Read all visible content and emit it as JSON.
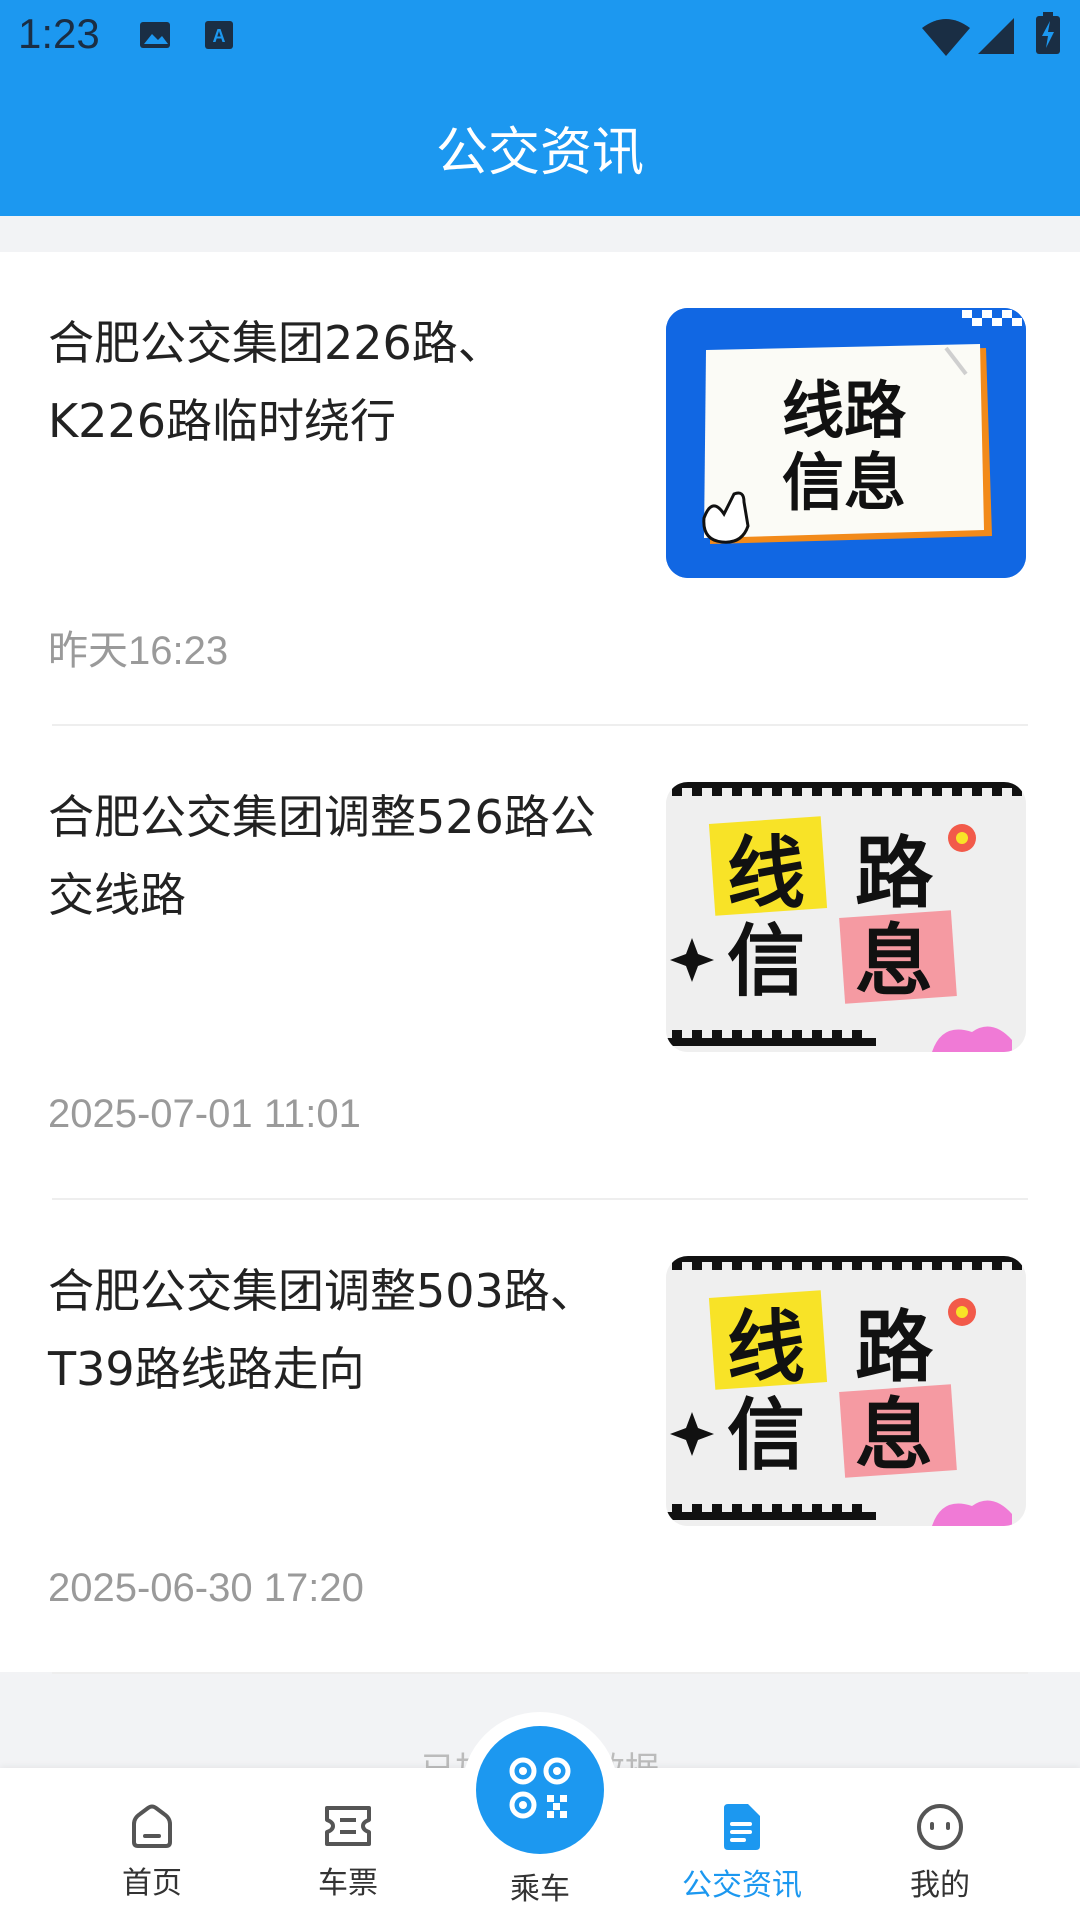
{
  "status_bar": {
    "time": "1:23",
    "icons": [
      "image-icon",
      "a-box-icon",
      "wifi-icon",
      "signal-icon",
      "battery-charging-icon"
    ]
  },
  "header": {
    "title": "公交资讯"
  },
  "news": [
    {
      "title": "合肥公交集团226路、K226路临时绕行",
      "date": "昨天16:23",
      "thumb_text": [
        "线路",
        "信息"
      ],
      "thumb_style": "blue"
    },
    {
      "title": "合肥公交集团调整526路公交线路",
      "date": "2025-07-01 11:01",
      "thumb_text": [
        "线",
        "路",
        "信",
        "息"
      ],
      "thumb_style": "gray"
    },
    {
      "title": "合肥公交集团调整503路、T39路线路走向",
      "date": "2025-06-30 17:20",
      "thumb_text": [
        "线",
        "路",
        "信",
        "息"
      ],
      "thumb_style": "gray"
    }
  ],
  "list_footer": "已加载全部数据",
  "tabbar": {
    "tabs": [
      {
        "label": "首页",
        "icon": "home-icon"
      },
      {
        "label": "车票",
        "icon": "ticket-icon"
      },
      {
        "label": "乘车",
        "icon": "qr-code-icon"
      },
      {
        "label": "公交资讯",
        "icon": "document-icon",
        "active": true
      },
      {
        "label": "我的",
        "icon": "profile-face-icon"
      }
    ]
  },
  "colors": {
    "primary": "#1c98f0",
    "thumb_blue": "#1167e3",
    "yellow_hl": "#f8e327",
    "pink_hl": "#f59aa2"
  }
}
